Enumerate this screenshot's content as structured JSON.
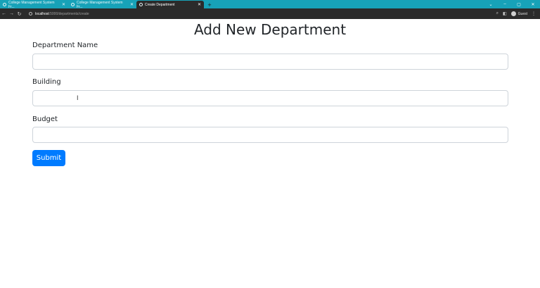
{
  "browser": {
    "tabs": [
      {
        "label": "College Management System Fr...",
        "active": false
      },
      {
        "label": "College Management System Fr...",
        "active": false
      },
      {
        "label": "Create Department",
        "active": true
      }
    ],
    "url_host": "localhost",
    "url_path": ":5000/departments/create",
    "profile_name": "Guest"
  },
  "page": {
    "title": "Add New Department"
  },
  "form": {
    "department_name_label": "Department Name",
    "department_name_value": "",
    "building_label": "Building",
    "building_value": "",
    "budget_label": "Budget",
    "budget_value": "",
    "submit_label": "Submit"
  },
  "colors": {
    "tabbar": "#17a2b8",
    "submit": "#007bff"
  }
}
